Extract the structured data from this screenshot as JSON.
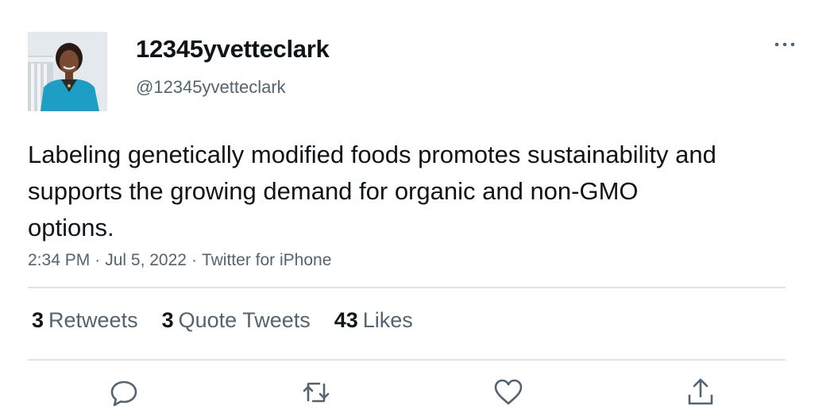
{
  "author": {
    "display_name": "12345yvetteclark",
    "handle": "@12345yvetteclark"
  },
  "tweet": {
    "text": "Labeling genetically modified foods promotes sustainability and supports the growing demand for organic and non-GMO options.",
    "time": "2:34 PM",
    "date": "Jul 5, 2022",
    "source": "Twitter for iPhone",
    "separator": "·"
  },
  "stats": {
    "retweets_count": "3",
    "retweets_label": "Retweets",
    "quotes_count": "3",
    "quotes_label": "Quote Tweets",
    "likes_count": "43",
    "likes_label": "Likes"
  },
  "icons": {
    "more": "more-horizontal-icon",
    "reply": "reply-icon",
    "retweet": "retweet-icon",
    "like": "heart-icon",
    "share": "share-icon"
  },
  "colors": {
    "text_primary": "#0f1419",
    "text_secondary": "#536471",
    "divider": "#dde3e8"
  }
}
